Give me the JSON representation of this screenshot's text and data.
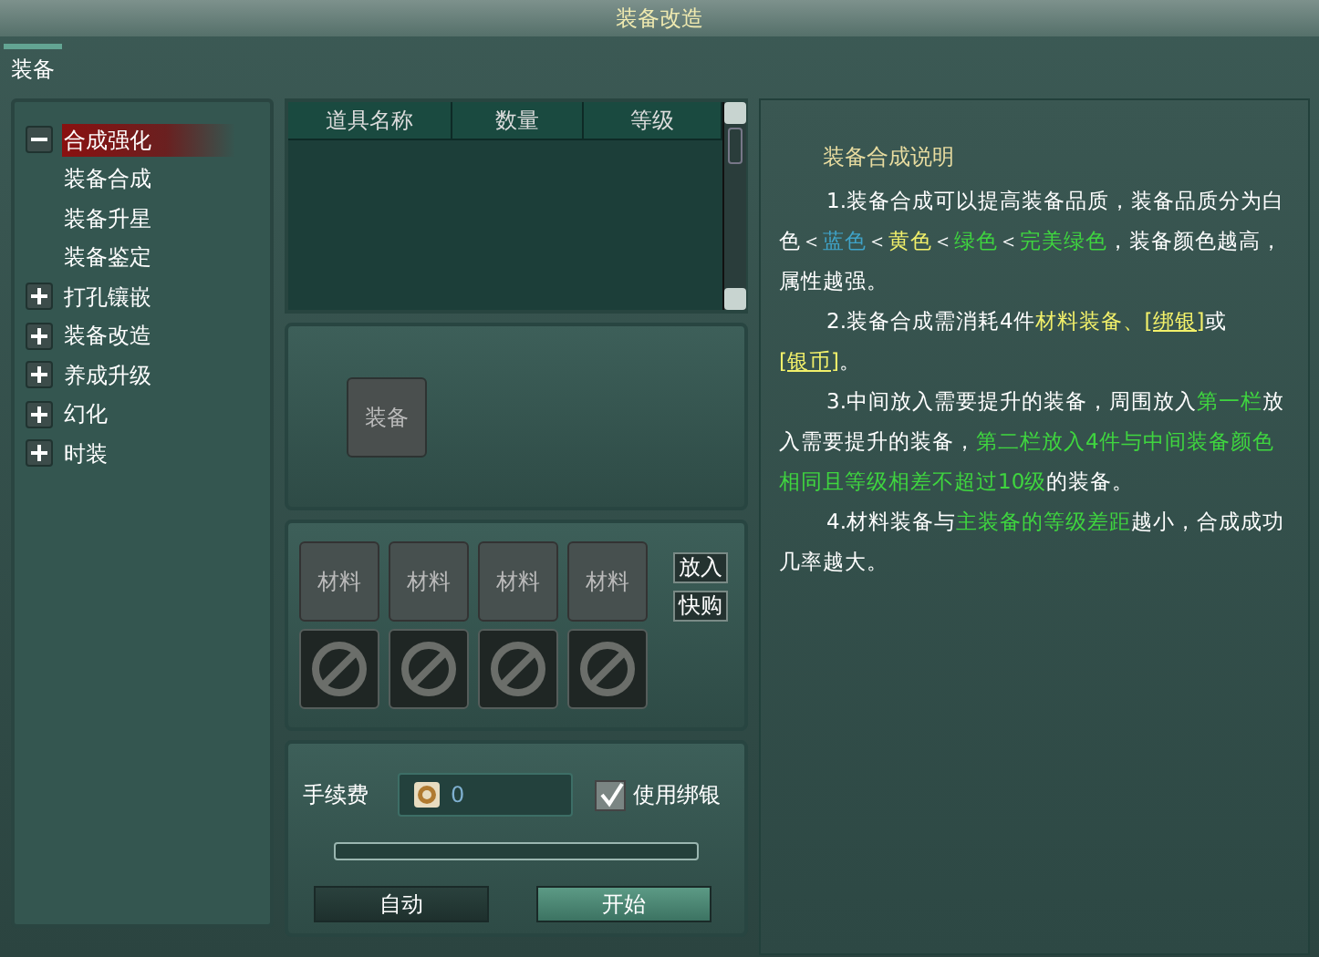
{
  "window": {
    "title": "装备改造"
  },
  "tabs": [
    {
      "label": "装备",
      "selected": true
    }
  ],
  "tree": [
    {
      "label": "合成强化",
      "expanded": true,
      "selected": true,
      "children": [
        {
          "label": "装备合成",
          "selected": false
        },
        {
          "label": "装备升星",
          "selected": false
        },
        {
          "label": "装备鉴定",
          "selected": false
        }
      ]
    },
    {
      "label": "打孔镶嵌",
      "expanded": false,
      "selected": false
    },
    {
      "label": "装备改造",
      "expanded": false,
      "selected": false
    },
    {
      "label": "养成升级",
      "expanded": false,
      "selected": false
    },
    {
      "label": "幻化",
      "expanded": false,
      "selected": false
    },
    {
      "label": "时装",
      "expanded": false,
      "selected": false
    }
  ],
  "table": {
    "columns": [
      "道具名称",
      "数量",
      "等级"
    ]
  },
  "equip_slot": {
    "label": "装备"
  },
  "material_slots": [
    {
      "label": "材料"
    },
    {
      "label": "材料"
    },
    {
      "label": "材料"
    },
    {
      "label": "材料"
    }
  ],
  "material_buttons": [
    "放入",
    "快购"
  ],
  "fee": {
    "label": "手续费",
    "value": "0"
  },
  "use_bound_silver": {
    "label": "使用绑银",
    "checked": true
  },
  "buttons": [
    {
      "label": "自动",
      "primary": false
    },
    {
      "label": "开始",
      "primary": true
    }
  ],
  "description": {
    "title": "装备合成说明",
    "paragraphs": [
      [
        {
          "kind": "text",
          "text": "1.装备合成可以提高装备品质，装备品质分为白色＜"
        },
        {
          "kind": "text",
          "text": "蓝色",
          "color": "#3fa3c8"
        },
        {
          "kind": "text",
          "text": "＜"
        },
        {
          "kind": "text",
          "text": "黄色",
          "color": "#f2f06a"
        },
        {
          "kind": "text",
          "text": "＜"
        },
        {
          "kind": "text",
          "text": "绿色",
          "color": "#3fd63f"
        },
        {
          "kind": "text",
          "text": "＜"
        },
        {
          "kind": "text",
          "text": "完美绿色",
          "color": "#3fd63f"
        },
        {
          "kind": "text",
          "text": "，装备颜色越高，属性越强。"
        }
      ],
      [
        {
          "kind": "text",
          "text": "2.装备合成需消耗4件"
        },
        {
          "kind": "text",
          "text": "材料装备、",
          "color": "#f2f06a"
        },
        {
          "kind": "link",
          "text": "[绑银]",
          "color": "#f2f06a"
        },
        {
          "kind": "text",
          "text": "或"
        },
        {
          "kind": "link",
          "text": "[银币]",
          "color": "#f2f06a"
        },
        {
          "kind": "text",
          "text": "。"
        }
      ],
      [
        {
          "kind": "text",
          "text": "3.中间放入需要提升的装备，周围放入"
        },
        {
          "kind": "text",
          "text": "第一栏",
          "color": "#3fd63f"
        },
        {
          "kind": "text",
          "text": "放入需要提升的装备，"
        },
        {
          "kind": "text",
          "text": "第二栏放入4件与中间装备颜色相同且等级相差不超过10级",
          "color": "#3fd63f"
        },
        {
          "kind": "text",
          "text": "的装备。"
        }
      ],
      [
        {
          "kind": "text",
          "text": "4.材料装备与"
        },
        {
          "kind": "text",
          "text": "主装备的等级差距",
          "color": "#3fd63f"
        },
        {
          "kind": "text",
          "text": "越小，合成成功几率越大。"
        }
      ]
    ]
  }
}
